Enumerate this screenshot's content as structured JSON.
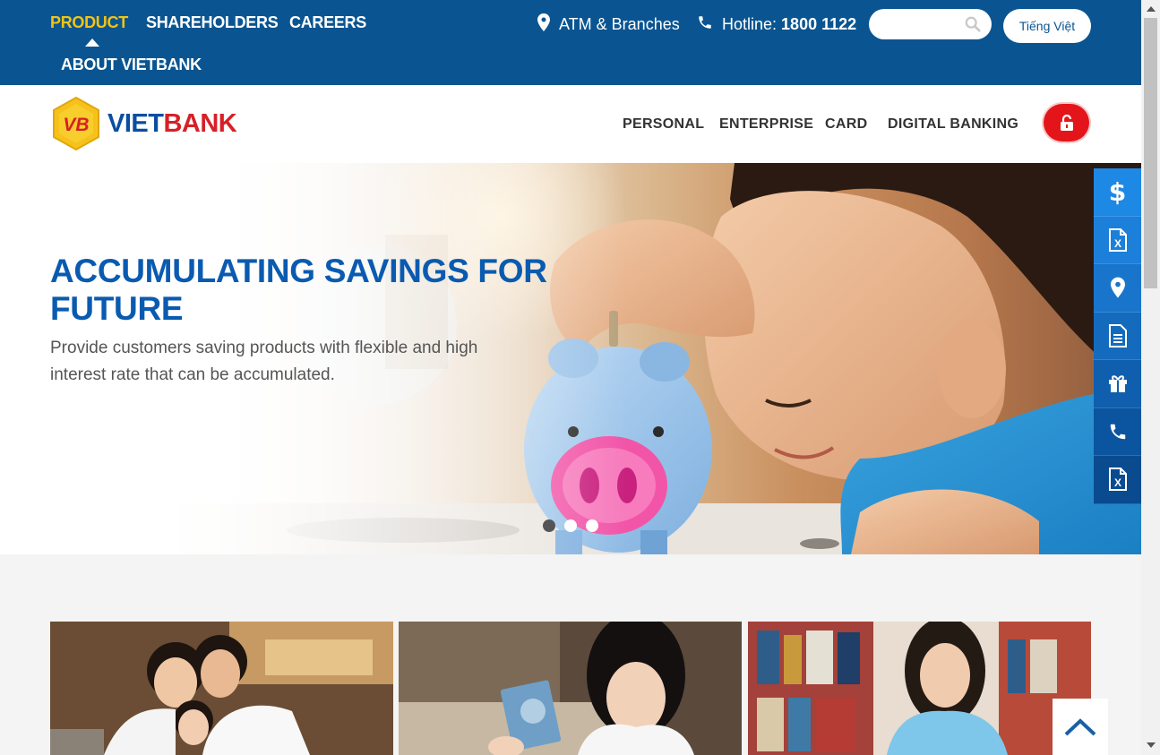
{
  "topnav": {
    "items": [
      {
        "label": "PRODUCT",
        "active": true
      },
      {
        "label": "SHAREHOLDERS",
        "active": false
      },
      {
        "label": "CAREERS",
        "active": false
      },
      {
        "label": "ABOUT VIETBANK",
        "active": false
      }
    ],
    "atm_label": "ATM & Branches",
    "hotline_label": "Hotline:",
    "hotline_number": "1800 1122",
    "search_placeholder": "",
    "language_label": "Tiếng Việt"
  },
  "header": {
    "logo_mark": "VB",
    "logo_viet": "VIET",
    "logo_bank": "BANK",
    "nav": [
      {
        "label": "PERSONAL"
      },
      {
        "label": "ENTERPRISE"
      },
      {
        "label": "CARD"
      },
      {
        "label": "DIGITAL BANKING"
      }
    ],
    "login_icon": "unlock-icon"
  },
  "hero": {
    "title": "ACCUMULATING SAVINGS FOR FUTURE",
    "subtitle": "Provide customers saving products with flexible and high interest rate that can be accumulated.",
    "slide_count": 3,
    "active_slide": 1
  },
  "side_toolbar": [
    {
      "icon": "dollar-icon",
      "color": "#1e88e5"
    },
    {
      "icon": "excel-icon",
      "color": "#1c7fd9"
    },
    {
      "icon": "location-pin-icon",
      "color": "#1975cc"
    },
    {
      "icon": "document-icon",
      "color": "#146bbd"
    },
    {
      "icon": "gift-icon",
      "color": "#0f5fae"
    },
    {
      "icon": "phone-icon",
      "color": "#0b549f"
    },
    {
      "icon": "excel-icon",
      "color": "#0a4b90"
    }
  ],
  "cards": [
    {
      "name": "family-card"
    },
    {
      "name": "savings-book-card"
    },
    {
      "name": "student-card"
    }
  ],
  "colors": {
    "topbar": "#0a5591",
    "active_nav": "#f3c313",
    "hero_title": "#0a5bb0",
    "login_button": "#e3151a"
  }
}
